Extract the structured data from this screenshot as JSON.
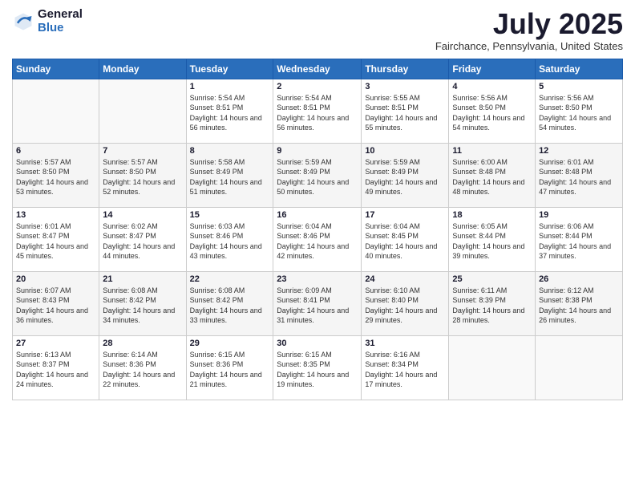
{
  "header": {
    "logo_general": "General",
    "logo_blue": "Blue",
    "month_title": "July 2025",
    "location": "Fairchance, Pennsylvania, United States"
  },
  "days_of_week": [
    "Sunday",
    "Monday",
    "Tuesday",
    "Wednesday",
    "Thursday",
    "Friday",
    "Saturday"
  ],
  "weeks": [
    [
      {
        "day": "",
        "info": ""
      },
      {
        "day": "",
        "info": ""
      },
      {
        "day": "1",
        "info": "Sunrise: 5:54 AM\nSunset: 8:51 PM\nDaylight: 14 hours and 56 minutes."
      },
      {
        "day": "2",
        "info": "Sunrise: 5:54 AM\nSunset: 8:51 PM\nDaylight: 14 hours and 56 minutes."
      },
      {
        "day": "3",
        "info": "Sunrise: 5:55 AM\nSunset: 8:51 PM\nDaylight: 14 hours and 55 minutes."
      },
      {
        "day": "4",
        "info": "Sunrise: 5:56 AM\nSunset: 8:50 PM\nDaylight: 14 hours and 54 minutes."
      },
      {
        "day": "5",
        "info": "Sunrise: 5:56 AM\nSunset: 8:50 PM\nDaylight: 14 hours and 54 minutes."
      }
    ],
    [
      {
        "day": "6",
        "info": "Sunrise: 5:57 AM\nSunset: 8:50 PM\nDaylight: 14 hours and 53 minutes."
      },
      {
        "day": "7",
        "info": "Sunrise: 5:57 AM\nSunset: 8:50 PM\nDaylight: 14 hours and 52 minutes."
      },
      {
        "day": "8",
        "info": "Sunrise: 5:58 AM\nSunset: 8:49 PM\nDaylight: 14 hours and 51 minutes."
      },
      {
        "day": "9",
        "info": "Sunrise: 5:59 AM\nSunset: 8:49 PM\nDaylight: 14 hours and 50 minutes."
      },
      {
        "day": "10",
        "info": "Sunrise: 5:59 AM\nSunset: 8:49 PM\nDaylight: 14 hours and 49 minutes."
      },
      {
        "day": "11",
        "info": "Sunrise: 6:00 AM\nSunset: 8:48 PM\nDaylight: 14 hours and 48 minutes."
      },
      {
        "day": "12",
        "info": "Sunrise: 6:01 AM\nSunset: 8:48 PM\nDaylight: 14 hours and 47 minutes."
      }
    ],
    [
      {
        "day": "13",
        "info": "Sunrise: 6:01 AM\nSunset: 8:47 PM\nDaylight: 14 hours and 45 minutes."
      },
      {
        "day": "14",
        "info": "Sunrise: 6:02 AM\nSunset: 8:47 PM\nDaylight: 14 hours and 44 minutes."
      },
      {
        "day": "15",
        "info": "Sunrise: 6:03 AM\nSunset: 8:46 PM\nDaylight: 14 hours and 43 minutes."
      },
      {
        "day": "16",
        "info": "Sunrise: 6:04 AM\nSunset: 8:46 PM\nDaylight: 14 hours and 42 minutes."
      },
      {
        "day": "17",
        "info": "Sunrise: 6:04 AM\nSunset: 8:45 PM\nDaylight: 14 hours and 40 minutes."
      },
      {
        "day": "18",
        "info": "Sunrise: 6:05 AM\nSunset: 8:44 PM\nDaylight: 14 hours and 39 minutes."
      },
      {
        "day": "19",
        "info": "Sunrise: 6:06 AM\nSunset: 8:44 PM\nDaylight: 14 hours and 37 minutes."
      }
    ],
    [
      {
        "day": "20",
        "info": "Sunrise: 6:07 AM\nSunset: 8:43 PM\nDaylight: 14 hours and 36 minutes."
      },
      {
        "day": "21",
        "info": "Sunrise: 6:08 AM\nSunset: 8:42 PM\nDaylight: 14 hours and 34 minutes."
      },
      {
        "day": "22",
        "info": "Sunrise: 6:08 AM\nSunset: 8:42 PM\nDaylight: 14 hours and 33 minutes."
      },
      {
        "day": "23",
        "info": "Sunrise: 6:09 AM\nSunset: 8:41 PM\nDaylight: 14 hours and 31 minutes."
      },
      {
        "day": "24",
        "info": "Sunrise: 6:10 AM\nSunset: 8:40 PM\nDaylight: 14 hours and 29 minutes."
      },
      {
        "day": "25",
        "info": "Sunrise: 6:11 AM\nSunset: 8:39 PM\nDaylight: 14 hours and 28 minutes."
      },
      {
        "day": "26",
        "info": "Sunrise: 6:12 AM\nSunset: 8:38 PM\nDaylight: 14 hours and 26 minutes."
      }
    ],
    [
      {
        "day": "27",
        "info": "Sunrise: 6:13 AM\nSunset: 8:37 PM\nDaylight: 14 hours and 24 minutes."
      },
      {
        "day": "28",
        "info": "Sunrise: 6:14 AM\nSunset: 8:36 PM\nDaylight: 14 hours and 22 minutes."
      },
      {
        "day": "29",
        "info": "Sunrise: 6:15 AM\nSunset: 8:36 PM\nDaylight: 14 hours and 21 minutes."
      },
      {
        "day": "30",
        "info": "Sunrise: 6:15 AM\nSunset: 8:35 PM\nDaylight: 14 hours and 19 minutes."
      },
      {
        "day": "31",
        "info": "Sunrise: 6:16 AM\nSunset: 8:34 PM\nDaylight: 14 hours and 17 minutes."
      },
      {
        "day": "",
        "info": ""
      },
      {
        "day": "",
        "info": ""
      }
    ]
  ]
}
